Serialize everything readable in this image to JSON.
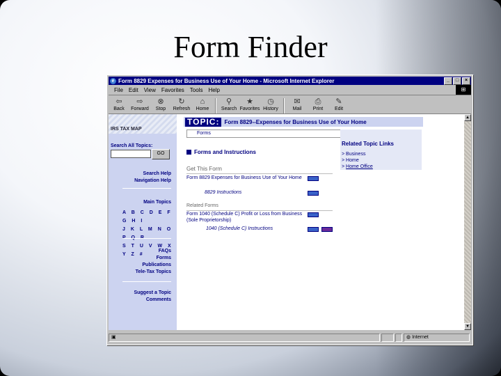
{
  "slide": {
    "title": "Form Finder"
  },
  "window": {
    "title": "Form 8829 Expenses for Business Use of Your Home - Microsoft Internet Explorer",
    "controls": {
      "minimize": "_",
      "maximize": "□",
      "close": "×"
    }
  },
  "menu": [
    "File",
    "Edit",
    "View",
    "Favorites",
    "Tools",
    "Help"
  ],
  "toolbar": [
    {
      "label": "Back",
      "icon": "back-arrow-icon"
    },
    {
      "label": "Forward",
      "icon": "forward-arrow-icon"
    },
    {
      "label": "Stop",
      "icon": "stop-icon"
    },
    {
      "label": "Refresh",
      "icon": "refresh-icon"
    },
    {
      "label": "Home",
      "icon": "home-icon"
    },
    {
      "label": "Search",
      "icon": "search-icon"
    },
    {
      "label": "Favorites",
      "icon": "favorites-icon"
    },
    {
      "label": "History",
      "icon": "history-icon"
    },
    {
      "label": "Mail",
      "icon": "mail-icon"
    },
    {
      "label": "Print",
      "icon": "print-icon"
    },
    {
      "label": "Edit",
      "icon": "edit-icon"
    }
  ],
  "sidebar": {
    "logo": "IRS TAX MAP",
    "search_label": "Search All Topics:",
    "go": "GO",
    "help_links": [
      "Search Help",
      "Navigation Help"
    ],
    "main_topics": "Main Topics",
    "alphabet": [
      "A B C D E F G H I",
      "J K L M N O P Q R",
      "S T U V W X Y Z #"
    ],
    "resource_links": [
      "FAQs",
      "Forms",
      "Publications",
      "Tele-Tax Topics"
    ],
    "feedback_links": [
      "Suggest a Topic",
      "Comments"
    ]
  },
  "main": {
    "topic_word": "TOPIC:",
    "topic_title": "Form 8829--Expenses for Business Use of Your Home",
    "forms_box": "Forms",
    "section_title": "Forms and Instructions",
    "get_this_form": "Get This Form",
    "form_link": "Form 8829 Expenses for Business Use of Your Home",
    "form_instructions": "8829 Instructions",
    "related_forms": "Related Forms",
    "related_form_link": "Form 1040 (Schedule C) Profit or Loss from Business (Sole Proprietorship)",
    "related_instructions": "1040 (Schedule C) Instructions"
  },
  "related_topics": {
    "title": "Related Topic Links",
    "items": [
      "Business",
      "Home",
      "Home Office"
    ]
  },
  "statusbar": {
    "zone": "Internet"
  },
  "colors": {
    "accent": "#000080",
    "sidebar": "#ccd3f0",
    "chrome": "#c0c0c0"
  }
}
